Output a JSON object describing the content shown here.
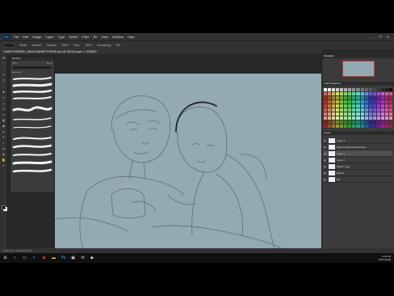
{
  "app": {
    "menu": [
      "File",
      "Edit",
      "Image",
      "Layer",
      "Type",
      "Select",
      "Filter",
      "3D",
      "View",
      "Window",
      "Help"
    ],
    "window_controls": [
      "–",
      "❐",
      "✕"
    ],
    "document_tab": "CHAIN ENGRISH_RAILGUNNER PHONE.psd @ 100% (Layer 1, RGB/8) *"
  },
  "options_bar": [
    "Mode:",
    "Normal",
    "Opacity:",
    "100%",
    "Flow:",
    "100%",
    "Smoothing:",
    "0%"
  ],
  "status_bar": "100%   Doc: 20.0M/195.4M",
  "brushes_panel": {
    "tab": "Brushes",
    "size_label": "Size:",
    "size_value": "30 px",
    "group_label": "▸ ▸ ▸ ▸ ▸"
  },
  "right_panels": {
    "navigator_tab": "Navigator",
    "swatches_tab": "Color  Swatches",
    "layers_tab": "Layers",
    "layers": [
      {
        "name": "Layer 3"
      },
      {
        "name": "Base of sketch/lineart/color"
      },
      {
        "name": "Layer 1"
      },
      {
        "name": "Layer 2"
      },
      {
        "name": "Sketch copy"
      },
      {
        "name": "Sketch"
      },
      {
        "name": "BG"
      }
    ]
  },
  "taskbar": {
    "icons": [
      "windows-icon",
      "search-icon",
      "task-view-icon",
      "edge-icon",
      "chrome-icon",
      "folder-icon",
      "photoshop-icon",
      "store-icon",
      "mail-icon",
      "media-icon"
    ],
    "time": "3:12 PM",
    "date": "2018-08-08"
  },
  "colors": {
    "canvas": "#93aab2",
    "ui_dark": "#282828",
    "ui_panel": "#3b3b3b",
    "accent": "#31a8ff"
  }
}
